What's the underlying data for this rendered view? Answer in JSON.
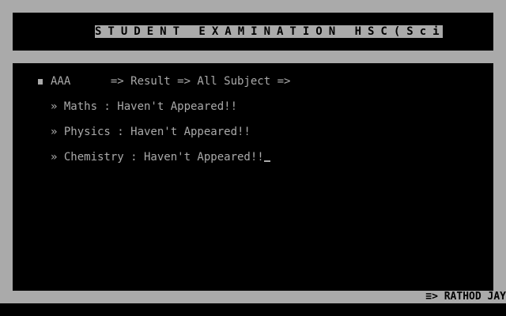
{
  "header": {
    "title": "STUDENT EXAMINATION HSC(Sci)"
  },
  "main": {
    "student_line": "AAA      => Result => All Subject =>",
    "subjects": [
      {
        "line": "» Maths : Haven't Appeared!!"
      },
      {
        "line": "» Physics : Haven't Appeared!!"
      },
      {
        "line": "» Chemistry : Haven't Appeared!!"
      }
    ]
  },
  "footer": {
    "credit": "≡> RATHOD JAY"
  },
  "colors": {
    "background": "#aaaaaa",
    "panel": "#000000",
    "text": "#aaaaaa"
  }
}
